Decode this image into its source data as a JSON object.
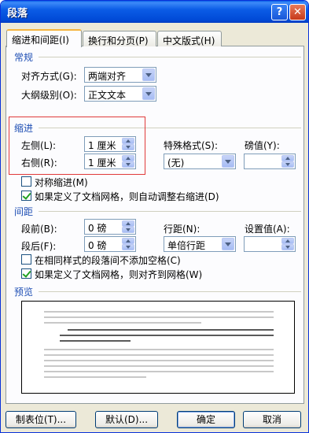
{
  "window": {
    "title": "段落",
    "help_glyph": "?",
    "close_glyph": "✕"
  },
  "tabs": [
    {
      "label": "缩进和间距(I)"
    },
    {
      "label": "换行和分页(P)"
    },
    {
      "label": "中文版式(H)"
    }
  ],
  "general": {
    "section": "常规",
    "alignment_label": "对齐方式(G):",
    "alignment_value": "两端对齐",
    "outline_label": "大纲级别(O):",
    "outline_value": "正文文本"
  },
  "indent": {
    "section": "缩进",
    "left_label": "左侧(L):",
    "left_value": "1 厘米",
    "right_label": "右侧(R):",
    "right_value": "1 厘米",
    "special_label": "特殊格式(S):",
    "special_value": "(无)",
    "by_label": "磅值(Y):",
    "by_value": "",
    "mirror_label": "对称缩进(M)",
    "mirror_checked": false,
    "grid_right_label": "如果定义了文档网格，则自动调整右缩进(D)",
    "grid_right_checked": true
  },
  "spacing": {
    "section": "间距",
    "before_label": "段前(B):",
    "before_value": "0 磅",
    "after_label": "段后(F):",
    "after_value": "0 磅",
    "line_label": "行距(N):",
    "line_value": "单倍行距",
    "at_label": "设置值(A):",
    "at_value": "",
    "no_space_label": "在相同样式的段落间不添加空格(C)",
    "no_space_checked": false,
    "snap_grid_label": "如果定义了文档网格，则对齐到网格(W)",
    "snap_grid_checked": true
  },
  "preview": {
    "section": "预览"
  },
  "buttons": {
    "tabs": "制表位(T)...",
    "default": "默认(D)...",
    "ok": "确定",
    "cancel": "取消"
  }
}
